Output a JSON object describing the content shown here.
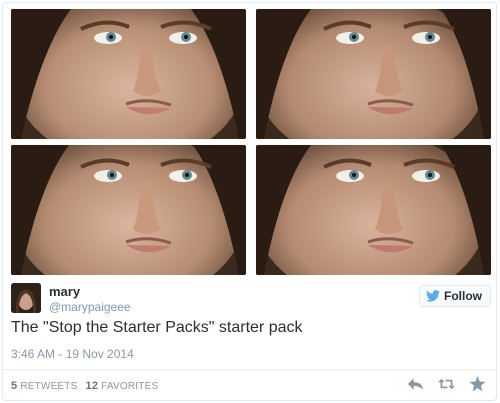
{
  "tweet": {
    "author": {
      "name": "mary",
      "handle": "@marypaigeee"
    },
    "follow_label": "Follow",
    "text": "The \"Stop the Starter Packs\" starter pack",
    "timestamp": "3:46 AM - 19 Nov 2014",
    "stats": {
      "retweets_count": "5",
      "retweets_label": "RETWEETS",
      "favorites_count": "12",
      "favorites_label": "FAVORITES"
    },
    "media": {
      "photo_count": 4
    },
    "icons": {
      "follow": "twitter-bird-icon",
      "reply": "reply-icon",
      "retweet": "retweet-icon",
      "favorite": "star-icon"
    },
    "colors": {
      "link": "#55acee",
      "muted": "#8899a6",
      "text": "#292f33"
    }
  }
}
